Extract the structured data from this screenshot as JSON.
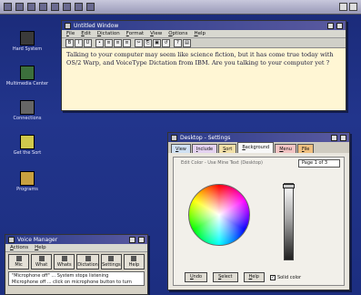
{
  "desktop": {
    "icons": [
      {
        "label": "Hard System",
        "color": "#3a3a3a"
      },
      {
        "label": "Multimedia Center",
        "color": "#3c6f3c"
      },
      {
        "label": "Connections",
        "color": "#666666"
      },
      {
        "label": "Get the Sort",
        "color": "#d0c84c"
      },
      {
        "label": "Programs",
        "color": "#c8a040"
      }
    ]
  },
  "editor": {
    "title": "Untitled Window",
    "menu": [
      "File",
      "Edit",
      "Dictation",
      "Format",
      "View",
      "Options",
      "Help"
    ],
    "tools": [
      "B",
      "I",
      "U",
      "•",
      "≡",
      "≡",
      "≡",
      "✂",
      "⎘",
      "▣",
      "↺",
      "?",
      "▤"
    ],
    "body": "Talking to your computer may seem like science fiction, but it has come true today with OS/2 Warp, and VoiceType Dictation from IBM. Are you talking to your computer yet ?"
  },
  "settings": {
    "title": "Desktop - Settings",
    "tabs": [
      {
        "label": "View",
        "color": "#cfe0f2"
      },
      {
        "label": "Include",
        "color": "#e4d2f0"
      },
      {
        "label": "Sort",
        "color": "#f2e0a8"
      },
      {
        "label": "Background",
        "color": "#f8f8f8"
      },
      {
        "label": "Menu",
        "color": "#f3c4c4"
      },
      {
        "label": "File",
        "color": "#f0c080"
      }
    ],
    "subtitle": "Edit Color - Use Mine Text (Desktop)",
    "page_indicator": "Page 1 of 3",
    "buttons": [
      "Undo",
      "Select",
      "Help"
    ],
    "checkbox": {
      "label": "Solid color",
      "checked": "✓"
    }
  },
  "voice": {
    "title": "Voice Manager",
    "menu": [
      "Actions",
      "Help"
    ],
    "buttons": [
      {
        "label": "Mic",
        "icon": "microphone-icon"
      },
      {
        "label": "What",
        "icon": "question-icon"
      },
      {
        "label": "Whats",
        "icon": "speech-icon"
      },
      {
        "label": "Dictation",
        "icon": "dictation-icon"
      },
      {
        "label": "Settings",
        "icon": "settings-icon"
      },
      {
        "label": "Help",
        "icon": "help-icon"
      }
    ],
    "status_line1": "\"Microphone off\" ... System stops listening",
    "status_line2": "Microphone off ... click on microphone button to turn"
  }
}
